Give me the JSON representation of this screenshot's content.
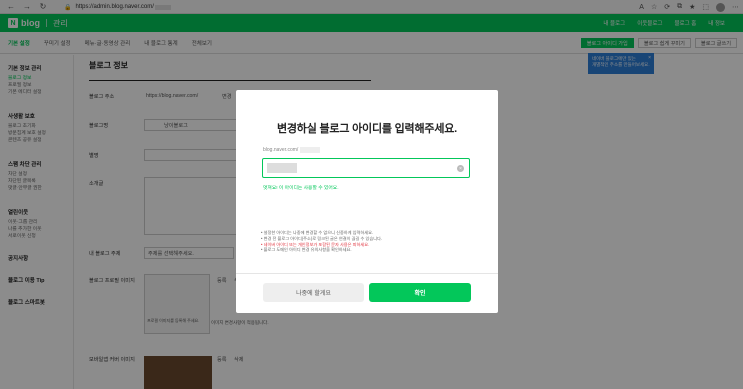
{
  "browser": {
    "url": "https://admin.blog.naver.com/",
    "back_icon": "←",
    "forward_icon": "→",
    "reload_icon": "↻"
  },
  "header": {
    "logo_n": "N",
    "logo_text": "blog",
    "admin_label": "관리",
    "nav": [
      "내 블로그",
      "이웃블로그",
      "블로그 홈",
      "내 정보"
    ]
  },
  "tabs": [
    "기본 설정",
    "꾸미기 설정",
    "메뉴·글·동영상 관리",
    "내 블로그 통계",
    "전체보기"
  ],
  "sub_buttons": [
    "블로그 아이디 가입",
    "블로그 쉽게 꾸미기",
    "블로그 글쓰기"
  ],
  "tooltip": {
    "line1": "네이버 블로그에만 있는",
    "line2": "개별적인 주소를 만들어보세요.",
    "close": "×"
  },
  "sidebar": {
    "groups": [
      {
        "title": "기본 정보 관리",
        "items": [
          "블로그 정보",
          "프로필 정보",
          "기본 에디터 설정"
        ]
      },
      {
        "title": "사생활 보호",
        "items": [
          "블로그 초기화",
          "방문집계 보호 설정",
          "콘텐츠 공유 설정"
        ]
      },
      {
        "title": "스팸 차단 관리",
        "items": [
          "차단 설정",
          "차단된 글목록",
          "댓글·안부글 권한"
        ]
      },
      {
        "title": "열린이웃",
        "items": [
          "이웃·그룹 관리",
          "나를 추가한 이웃",
          "서로이웃 신청"
        ]
      }
    ],
    "lone": [
      "공지사항",
      "블로그 이용 Tip",
      "블로그 스마트봇"
    ]
  },
  "main": {
    "title": "블로그 정보",
    "address_label": "블로그 주소",
    "address_value": "https://blog.naver.com/",
    "address_change": "변경",
    "name_label": "블로그명",
    "name_value": "냥이블로그",
    "alias_label": "별명",
    "intro_label": "소개글",
    "topic_label": "내 블로그 주제",
    "topic_value": "주제를 선택해주세요.",
    "profile_label": "블로그 프로필 이미지",
    "profile_hint": "프로필 이미지를 등록해 주세요.",
    "cover_label": "모바일앱 커버 이미지",
    "register": "등록",
    "delete": "삭제",
    "checkbox_text": "이미지 변경사항이 적용됩니다."
  },
  "modal": {
    "title": "변경하실 블로그 아이디를 입력해주세요.",
    "domain_prefix": "blog.naver.com/",
    "input_value": "",
    "ok_message": "멋져요! 이 아이디는 사용할 수 있어요.",
    "notes": [
      "• 설정한 아이디는 나중에 변경할 수 없으니 신중하게 입력하세요.",
      "• 변경 전 블로그 아이디(주소)로 링크된 글은 연결이 끊길 수 있습니다.",
      "• 네이버 아이디 또는 개인정보가 포함된 문자 사용은 피하세요.",
      "• 블로그 도메인 아이디 변경 유의사항을 확인하세요."
    ],
    "later_label": "나중에 할게요",
    "confirm_label": "확인",
    "clear_icon": "×"
  },
  "colors": {
    "brand": "#03c75a",
    "overlay": "rgba(0,0,0,0.45)",
    "warning": "#e0323d",
    "tooltip": "#2c7ed8"
  }
}
